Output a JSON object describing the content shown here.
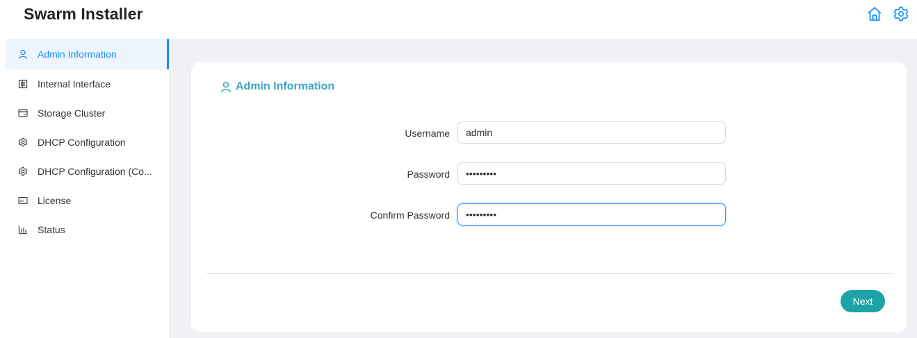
{
  "app": {
    "title": "Swarm Installer"
  },
  "header": {
    "icons": [
      "home-icon",
      "gear-icon"
    ]
  },
  "sidebar": {
    "items": [
      {
        "label": "Admin Information",
        "icon": "user-icon",
        "active": true
      },
      {
        "label": "Internal Interface",
        "icon": "list-icon",
        "active": false
      },
      {
        "label": "Storage Cluster",
        "icon": "storage-icon",
        "active": false
      },
      {
        "label": "DHCP Configuration",
        "icon": "gear-icon",
        "active": false
      },
      {
        "label": "DHCP Configuration (Co...",
        "icon": "gear-icon",
        "active": false
      },
      {
        "label": "License",
        "icon": "license-icon",
        "active": false
      },
      {
        "label": "Status",
        "icon": "bar-chart-icon",
        "active": false
      }
    ]
  },
  "main": {
    "section_title": "Admin Information",
    "form": {
      "username": {
        "label": "Username",
        "value": "admin"
      },
      "password": {
        "label": "Password",
        "value": "•••••••••"
      },
      "confirm_password": {
        "label": "Confirm Password",
        "value": "•••••••••"
      }
    },
    "next_label": "Next"
  },
  "colors": {
    "accent": "#1890ff",
    "section_title": "#3aa6c3",
    "button": "#1ca3a8",
    "background": "#f0f1f5"
  }
}
